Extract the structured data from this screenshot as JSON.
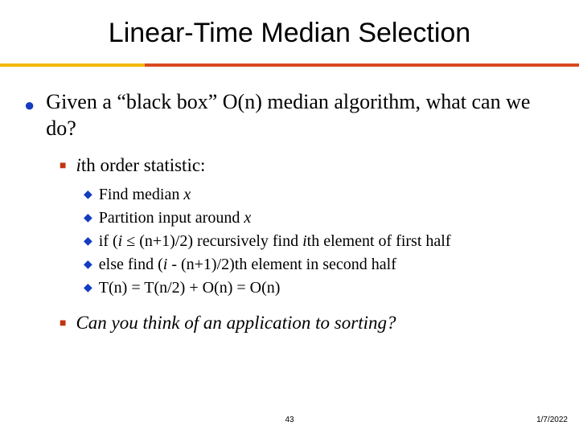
{
  "title": "Linear-Time Median Selection",
  "l1_text": "Given a “black box” O(n) median algorithm, what can we do?",
  "l2a_pre": "i",
  "l2a_post": "th order statistic:",
  "steps": {
    "s1_a": "Find median ",
    "s1_b": "x",
    "s2_a": "Partition input around ",
    "s2_b": "x",
    "s3_a": "if (",
    "s3_b": "i",
    "s3_c": " ≤ (n+1)/2)  recursively find ",
    "s3_d": "i",
    "s3_e": "th element of first half",
    "s4_a": "else find (",
    "s4_b": "i",
    "s4_c": " - (n+1)/2)th element in second half",
    "s5": "T(n) = T(n/2) + O(n) = O(n)"
  },
  "l2b_text": "Can you think of an application to sorting?",
  "page_number": "43",
  "date": "1/7/2022"
}
